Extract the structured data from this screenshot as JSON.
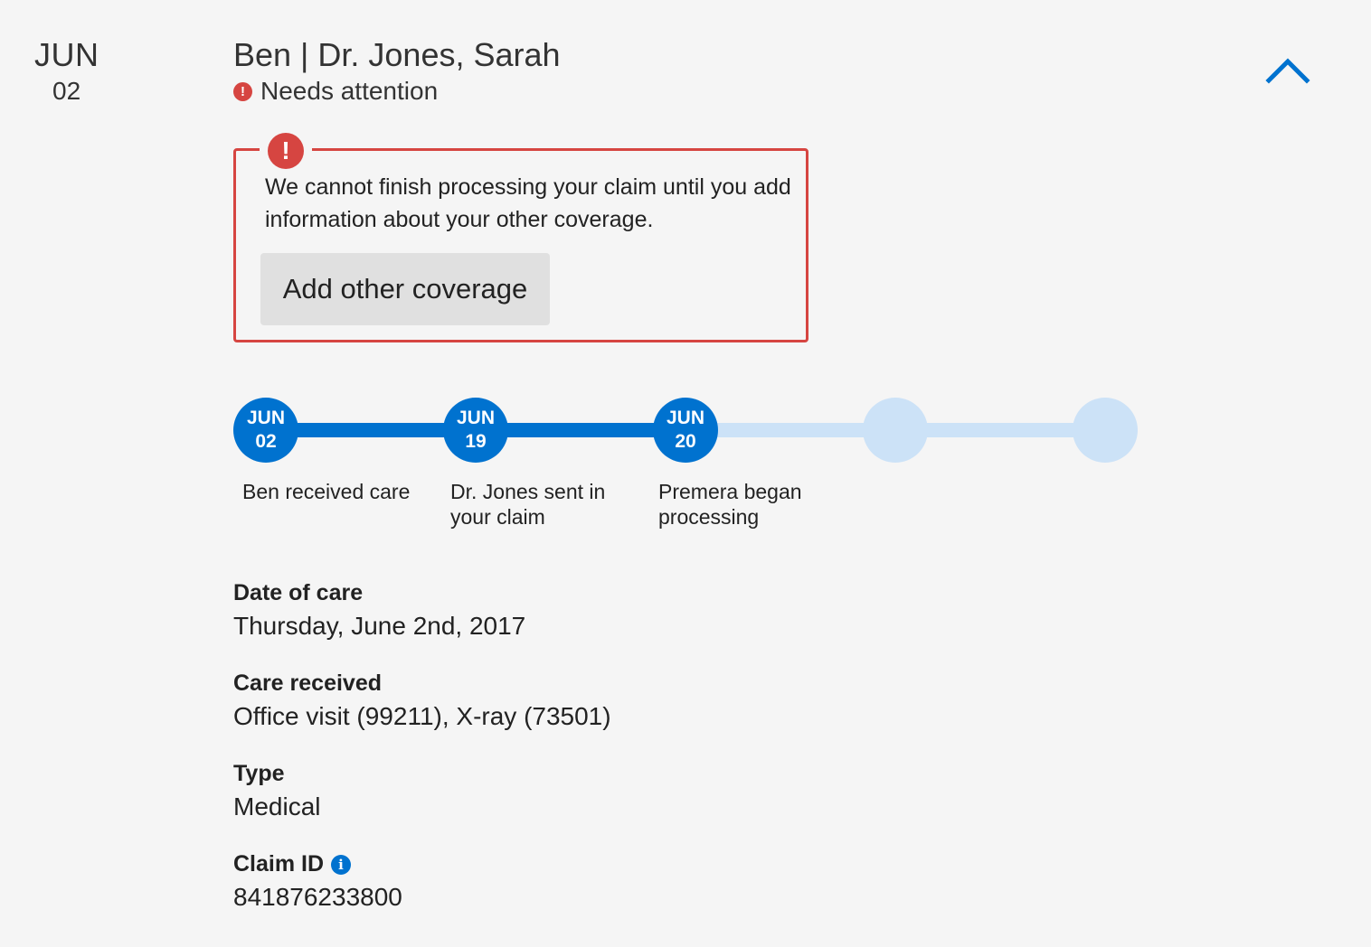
{
  "date": {
    "month": "JUN",
    "day": "02"
  },
  "claim": {
    "title": "Ben | Dr. Jones, Sarah",
    "status": "Needs attention"
  },
  "alert": {
    "icon": "exclamation-icon",
    "message": "We cannot finish processing your claim until you add information about your other coverage.",
    "button_label": "Add other coverage"
  },
  "timeline": {
    "steps": [
      {
        "month": "JUN",
        "day": "02",
        "caption": "Ben received care",
        "done": true
      },
      {
        "month": "JUN",
        "day": "19",
        "caption": "Dr. Jones sent in your claim",
        "done": true
      },
      {
        "month": "JUN",
        "day": "20",
        "caption": "Premera began processing",
        "done": true
      },
      {
        "month": "",
        "day": "",
        "caption": "",
        "done": false
      },
      {
        "month": "",
        "day": "",
        "caption": "",
        "done": false
      }
    ]
  },
  "details": {
    "date_of_care": {
      "label": "Date of care",
      "value": "Thursday, June 2nd, 2017"
    },
    "care_received": {
      "label": "Care received",
      "value": "Office visit (99211), X-ray (73501)"
    },
    "type": {
      "label": "Type",
      "value": "Medical"
    },
    "claim_id": {
      "label": "Claim ID",
      "value": "841876233800",
      "info_icon": "info-icon"
    }
  },
  "colors": {
    "background": "#f5f5f5",
    "alert_red": "#d64541",
    "progress_blue": "#0072cf",
    "progress_pending": "#cce2f7",
    "button_gray": "#e0e0e0"
  }
}
